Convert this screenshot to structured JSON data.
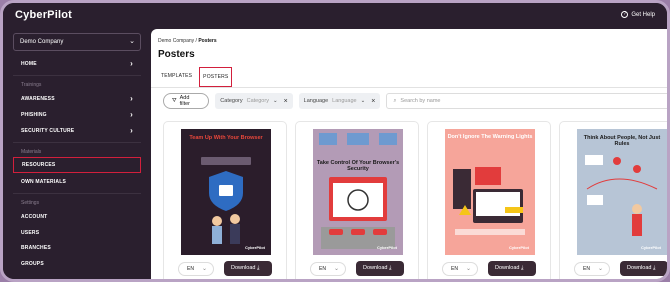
{
  "app": {
    "logo": "CyberPilot",
    "help_label": "Get Help"
  },
  "sidebar": {
    "company": "Demo Company",
    "home": "HOME",
    "sections": [
      {
        "title": "Trainings"
      },
      {
        "title": "Materials"
      },
      {
        "title": "Settings"
      }
    ],
    "awareness": "AWARENESS",
    "phishing": "PHISHING",
    "security_culture": "SECURITY CULTURE",
    "resources": "RESOURCES",
    "own_materials": "OWN MATERIALS",
    "account": "ACCOUNT",
    "users": "USERS",
    "branches": "BRANCHES",
    "groups": "GROUPS"
  },
  "main": {
    "breadcrumb_root": "Demo Company",
    "breadcrumb_sep": "/",
    "breadcrumb_current": "Posters",
    "title": "Posters",
    "tabs": [
      "TEMPLATES",
      "POSTERS"
    ],
    "add_filter": "Add filter",
    "category_label": "Category",
    "category_placeholder": "Category",
    "language_label": "Language",
    "language_placeholder": "Language",
    "search_placeholder": "Search by name"
  },
  "cards": [
    {
      "title": "Team Up With Your Browser",
      "brand": "CyberPilot",
      "lang": "EN",
      "download": "Download",
      "bg": "#2b1d2b",
      "title_color": "#e8473b"
    },
    {
      "title": "Take Control Of Your Browser's Security",
      "brand": "CyberPilot",
      "lang": "EN",
      "download": "Download",
      "bg": "#b39bb6",
      "title_color": "#1a1a1a"
    },
    {
      "title": "Don't Ignore The Warning Lights",
      "brand": "CyberPilot",
      "lang": "EN",
      "download": "Download",
      "bg": "#f6a59a",
      "title_color": "#ffffff"
    },
    {
      "title": "Think About People, Not Just Rules",
      "brand": "CyberPilot",
      "lang": "EN",
      "download": "Download",
      "bg": "#b7c5d6",
      "title_color": "#1a1a1a"
    }
  ],
  "colors": {
    "accent_red": "#d21f3c",
    "sidebar_bg": "#2a1f2e",
    "button_dark": "#3a2a35"
  }
}
